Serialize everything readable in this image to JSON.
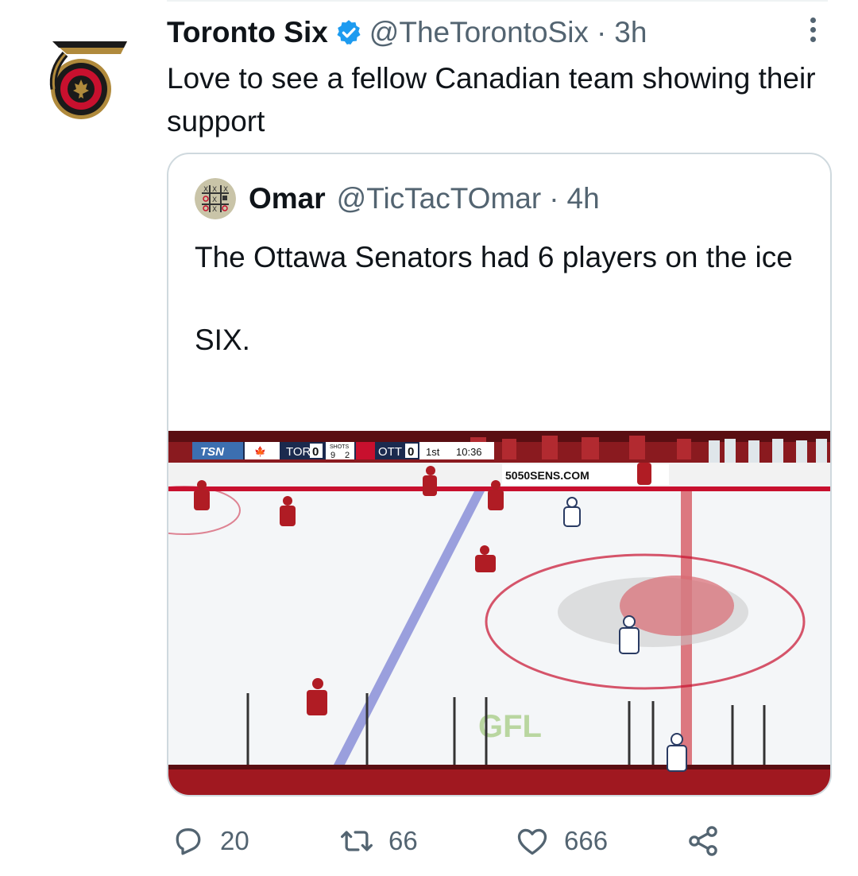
{
  "tweet": {
    "author_name": "Toronto Six",
    "handle": "@TheTorontoSix",
    "separator": "·",
    "time": "3h",
    "text": "Love to see a fellow Canadian team showing their support",
    "avatar_icon": "toronto-six-logo-icon",
    "verified_icon": "verified-badge-icon"
  },
  "quoted_tweet": {
    "author_name": "Omar",
    "handle": "@TicTacTOmar",
    "separator": "·",
    "time": "4h",
    "text_line1": "The Ottawa Senators had 6 players on the ice",
    "text_line2": "SIX.",
    "media": {
      "broadcaster": "TSN",
      "home_team": "TOR",
      "home_score": "0",
      "shots_label": "SHOTS",
      "home_shots": "9",
      "away_shots": "2",
      "away_team": "OTT",
      "away_score": "0",
      "period": "1st",
      "clock": "10:36",
      "board_ad": "5050SENS.COM",
      "ice_ad": "GFL"
    }
  },
  "actions": {
    "reply_count": "20",
    "retweet_count": "66",
    "like_count": "666"
  },
  "colors": {
    "accent": "#1d9bf0",
    "text": "#0f1419",
    "muted": "#536471",
    "border": "#cfd9de",
    "senators_red": "#c8102e"
  }
}
